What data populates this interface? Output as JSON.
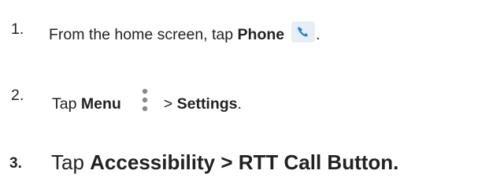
{
  "steps": [
    {
      "number": "1.",
      "before": "From the home screen, tap ",
      "bold": "Phone",
      "after": ".",
      "icon": "phone-icon"
    },
    {
      "number": "2.",
      "before": "Tap ",
      "bold": "Menu",
      "middle": "> ",
      "bold2": "Settings",
      "after": ".",
      "icon": "menu-icon"
    },
    {
      "number": "3.",
      "before": "Tap ",
      "bold": "Accessibility > RTT Call Button."
    }
  ],
  "colors": {
    "text": "#222222",
    "phone_icon_bg": "#e8eef6",
    "phone_icon_handset": "#2b7fd6",
    "menu_dots": "#8a8a8a"
  }
}
